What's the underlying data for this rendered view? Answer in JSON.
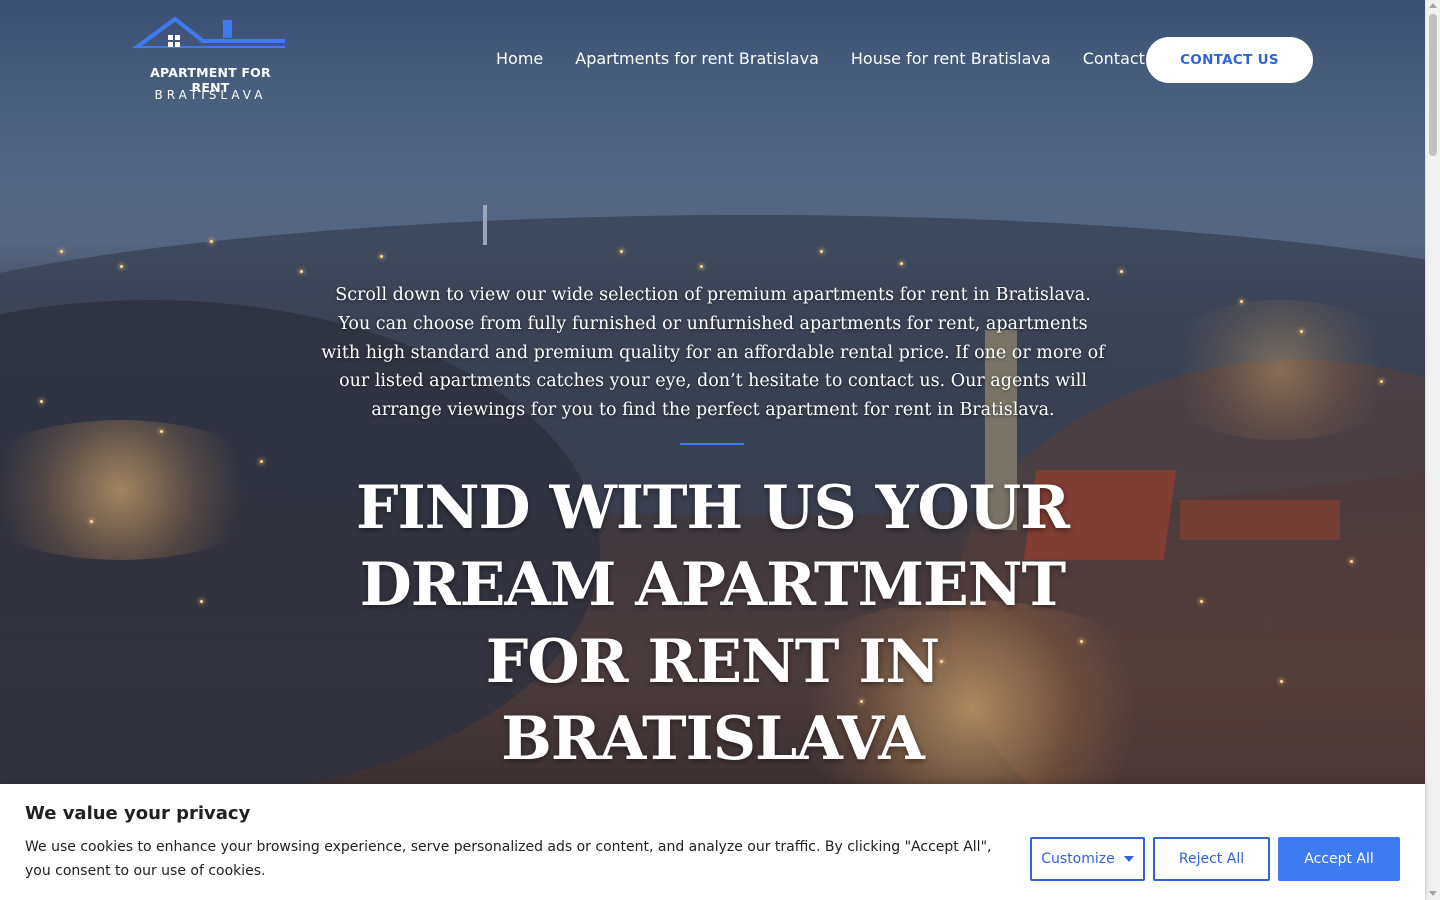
{
  "header": {
    "logo_title": "APARTMENT FOR RENT",
    "logo_subtitle": "BRATISLAVA",
    "nav": [
      {
        "label": "Home"
      },
      {
        "label": "Apartments for rent Bratislava"
      },
      {
        "label": "House for rent Bratislava"
      },
      {
        "label": "Contact"
      }
    ],
    "contact_button": "CONTACT US"
  },
  "hero": {
    "intro": "Scroll down to view our wide selection of premium apartments for rent in Bratislava. You can choose from fully furnished or unfurnished apartments for rent, apartments with high standard and premium quality for an affordable rental price. If one or more of our listed apartments catches your eye, don’t hesitate to contact us. Our agents will arrange viewings for you to find the perfect apartment for rent in Bratislava.",
    "headline": "FIND WITH US YOUR DREAM APARTMENT FOR RENT IN BRATISLAVA"
  },
  "cookie_banner": {
    "title": "We value your privacy",
    "text": "We use cookies to enhance your browsing experience, serve personalized ads or content, and analyze our traffic. By clicking \"Accept All\", you consent to our use of cookies.",
    "customize": "Customize",
    "reject": "Reject All",
    "accept": "Accept All"
  },
  "colors": {
    "accent": "#3f7bf0",
    "brand_text": "#2f63d6"
  },
  "icons": {
    "logo": "house-roof-icon",
    "customize_caret": "caret-down-icon"
  }
}
